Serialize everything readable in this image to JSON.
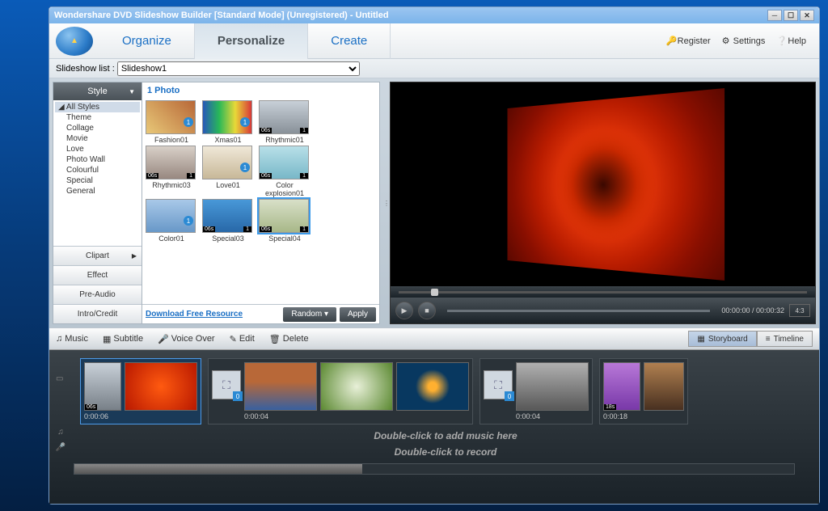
{
  "title": "Wondershare DVD Slideshow Builder [Standard Mode] (Unregistered) - Untitled",
  "tabs": {
    "organize": "Organize",
    "personalize": "Personalize",
    "create": "Create"
  },
  "header": {
    "register": "Register",
    "settings": "Settings",
    "help": "Help"
  },
  "slideshow": {
    "label": "Slideshow list :",
    "selected": "Slideshow1"
  },
  "style": {
    "tab": "Style",
    "tree": [
      "All Styles",
      "Theme",
      "Collage",
      "Movie",
      "Love",
      "Photo Wall",
      "Colourful",
      "Special",
      "General"
    ]
  },
  "sidebuttons": {
    "clipart": "Clipart",
    "effect": "Effect",
    "preaudio": "Pre-Audio",
    "introcredit": "Intro/Credit"
  },
  "gallery": {
    "head": "1 Photo",
    "items": [
      {
        "name": "Fashion01"
      },
      {
        "name": "Xmas01"
      },
      {
        "name": "Rhythmic01"
      },
      {
        "name": "Rhythmic03"
      },
      {
        "name": "Love01"
      },
      {
        "name": "Color explosion01"
      },
      {
        "name": "Color01"
      },
      {
        "name": "Special03"
      },
      {
        "name": "Special04"
      }
    ],
    "badge06": "06s",
    "badge1": "1",
    "download": "Download Free Resource",
    "random": "Random",
    "apply": "Apply"
  },
  "playback": {
    "time": "00:00:00 / 00:00:32",
    "ratio": "4:3"
  },
  "toolbar": {
    "music": "Music",
    "subtitle": "Subtitle",
    "voiceover": "Voice Over",
    "edit": "Edit",
    "delete": "Delete",
    "storyboard": "Storyboard",
    "timeline": "Timeline"
  },
  "story": {
    "clips": [
      {
        "dur": "0:00:06",
        "bg": "radial-gradient(circle,#ff5a10,#b81800)",
        "style": true
      },
      {
        "dur": "0:00:04",
        "bg": "linear-gradient(#b86838,#6e3818)"
      },
      {
        "dur": "",
        "bg": "radial-gradient(circle,#e8f0d8,#8ab060)"
      },
      {
        "dur": "",
        "bg": "radial-gradient(circle,#ffb030,#083860)"
      },
      {
        "dur": "0:00:04",
        "bg": "linear-gradient(#b0b0b0,#585858)"
      },
      {
        "dur": "0:00:18",
        "bg": "linear-gradient(#b08050,#584020)",
        "style18": true
      }
    ],
    "hint1": "Double-click to add music here",
    "hint2": "Double-click to record"
  }
}
